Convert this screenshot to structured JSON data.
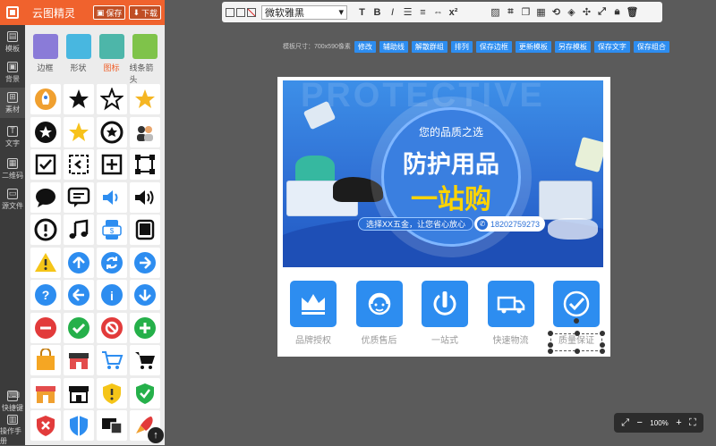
{
  "app": {
    "title": "云图精灵",
    "save": "保存",
    "download": "下载"
  },
  "rail": [
    {
      "label": "模板",
      "icon": "template-icon"
    },
    {
      "label": "背景",
      "icon": "background-icon"
    },
    {
      "label": "素材",
      "icon": "material-icon"
    },
    {
      "label": "文字",
      "icon": "text-icon"
    },
    {
      "label": "二维码",
      "icon": "qrcode-icon"
    },
    {
      "label": "源文件",
      "icon": "folder-icon"
    },
    {
      "label": "快捷键",
      "icon": "keyboard-icon"
    },
    {
      "label": "操作手册",
      "icon": "manual-icon"
    }
  ],
  "categories": [
    {
      "label": "边框",
      "color": "#8a7bd8"
    },
    {
      "label": "形状",
      "color": "#48b7e0"
    },
    {
      "label": "图标",
      "color": "#4db6a9"
    },
    {
      "label": "线条箭头",
      "color": "#7fc34a"
    }
  ],
  "active_category": "图标",
  "icons": [
    "rocket-icon",
    "star-icon",
    "star-outline-icon",
    "star-gold-icon",
    "star-circle-icon",
    "star-yellow-icon",
    "star-badge-icon",
    "people-icon",
    "checkbox-icon",
    "crop-icon",
    "plus-square-icon",
    "frame-icon",
    "chat-icon",
    "message-icon",
    "speaker-icon",
    "speaker-loud-icon",
    "warning-circle-icon",
    "music-icon",
    "payment-icon",
    "tablet-icon",
    "warning-icon",
    "up-arrow-icon",
    "refresh-icon",
    "right-arrow-icon",
    "question-icon",
    "left-arrow-icon",
    "info-icon",
    "down-arrow-icon",
    "minus-icon",
    "check-icon",
    "forbidden-icon",
    "add-icon",
    "bag-icon",
    "store-icon",
    "cart-icon",
    "cart-outline-icon",
    "shop-icon",
    "shop-outline-icon",
    "shield-warning-icon",
    "shield-check-icon",
    "shield-close-icon",
    "shield-icon",
    "devices-icon",
    "rocket-launch-icon"
  ],
  "toolbar": {
    "font": "微软雅黑",
    "bold": "B",
    "italic": "I",
    "text": "T",
    "superscript": "x²"
  },
  "actions": {
    "size_label": "模板尺寸：700x590像素",
    "buttons": [
      "修改",
      "辅助线",
      "解散群组",
      "排列",
      "保存边框",
      "更新模板",
      "另存模板",
      "保存文字",
      "保存组合"
    ]
  },
  "banner": {
    "bg_word": "PROTECTIVE",
    "line1": "您的品质之选",
    "line2": "防护用品",
    "line3": "一站购",
    "slogan": "选择XX五金，让您省心放心",
    "phone": "18202759273"
  },
  "features": [
    {
      "label": "品牌授权",
      "icon": "crown-icon"
    },
    {
      "label": "优质售后",
      "icon": "headset-icon"
    },
    {
      "label": "一站式",
      "icon": "power-icon"
    },
    {
      "label": "快速物流",
      "icon": "truck-icon"
    },
    {
      "label": "质量保证",
      "icon": "check-circle-icon"
    }
  ],
  "zoom": {
    "level": "100%"
  }
}
